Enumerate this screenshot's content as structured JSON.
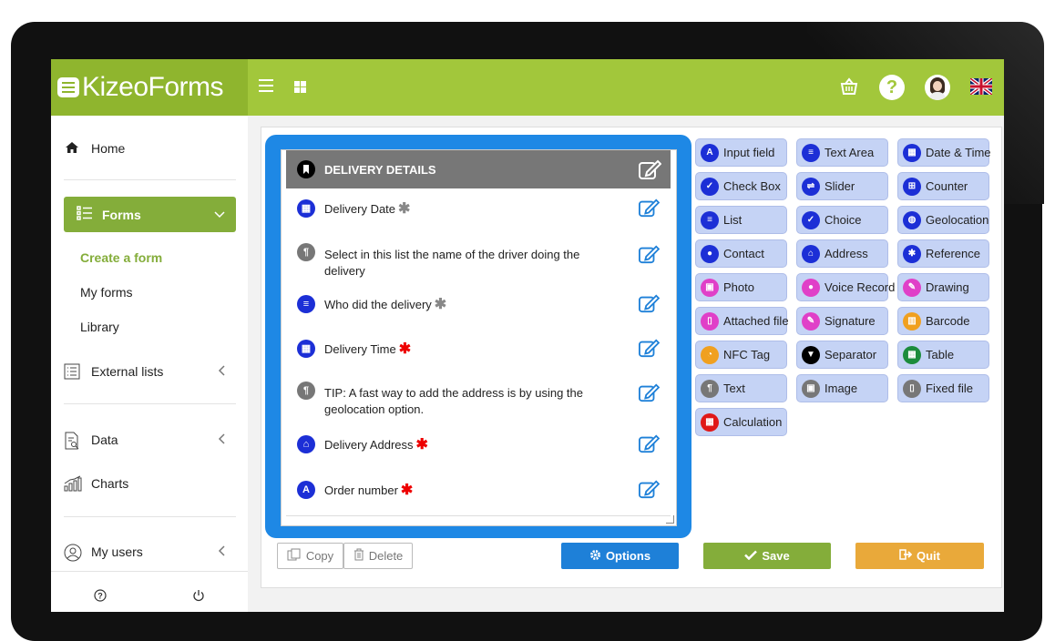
{
  "app": {
    "logo_text": "KizeoForms"
  },
  "sidebar": {
    "home": "Home",
    "forms": "Forms",
    "sub": [
      "Create a form",
      "My forms",
      "Library"
    ],
    "external_lists": "External lists",
    "data": "Data",
    "charts": "Charts",
    "my_users": "My users"
  },
  "editor": {
    "section_title": "DELIVERY DETAILS",
    "fields": [
      {
        "label": "Delivery Date",
        "required": "opt"
      },
      {
        "label": "Select in this list the name of the driver doing the delivery",
        "required": ""
      },
      {
        "label": "Who did the delivery",
        "required": "opt"
      },
      {
        "label": "Delivery Time",
        "required": "req"
      },
      {
        "label": "TIP: A fast way to add the address is by using the geolocation option.",
        "required": ""
      },
      {
        "label": "Delivery Address",
        "required": "req"
      },
      {
        "label": "Order number",
        "required": "req"
      }
    ],
    "asterisk": "✱"
  },
  "palette": [
    [
      "Input field",
      "Text Area",
      "Date & Time"
    ],
    [
      "Check Box",
      "Slider",
      "Counter"
    ],
    [
      "List",
      "Choice",
      "Geolocation"
    ],
    [
      "Contact",
      "Address",
      "Reference"
    ],
    [
      "Photo",
      "Voice Record",
      "Drawing"
    ],
    [
      "Attached file",
      "Signature",
      "Barcode"
    ],
    [
      "NFC Tag",
      "Separator",
      "Table"
    ],
    [
      "Text",
      "Image",
      "Fixed file"
    ],
    [
      "Calculation"
    ]
  ],
  "buttons": {
    "copy": "Copy",
    "delete": "Delete",
    "options": "Options",
    "save": "Save",
    "quit": "Quit"
  },
  "colors": {
    "brand_green": "#a2c73b",
    "editor_blue": "#1e88e5",
    "palette_bg": "#c5d3f5",
    "required_red": "#e00000"
  }
}
